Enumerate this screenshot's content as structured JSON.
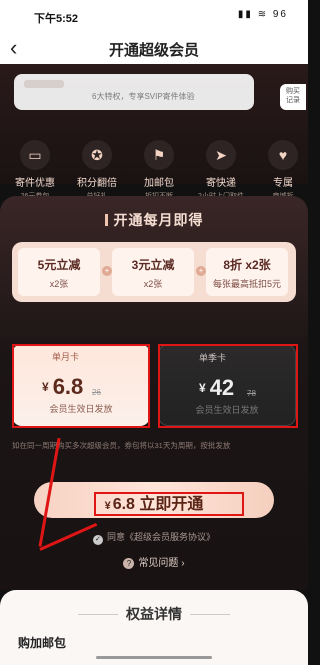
{
  "status_bar": {
    "time": "下午5:52",
    "icons": "▮▮ ≋ 96"
  },
  "nav": {
    "back": "‹",
    "title": "开通超级会员"
  },
  "member": {
    "subtitle": "6大特权，专享SVIP寄件体验",
    "buy_record": "购买\n记录"
  },
  "perks": [
    {
      "icon": "▭",
      "name": "寄件优惠",
      "desc": "26元券包"
    },
    {
      "icon": "✪",
      "name": "积分翻倍",
      "desc": "兑好礼"
    },
    {
      "icon": "⚑",
      "name": "加邮包",
      "desc": "折扣不断"
    },
    {
      "icon": "➤",
      "name": "寄快递",
      "desc": "2小时上门取件"
    },
    {
      "icon": "♥",
      "name": "专属",
      "desc": "商城折"
    }
  ],
  "panel": {
    "title": "开通每月即得"
  },
  "coupons": [
    {
      "title": "5元立减",
      "sub": "x2张"
    },
    {
      "title": "3元立减",
      "sub": "x2张"
    },
    {
      "title": "8折 x2张",
      "sub": "每张最高抵扣5元"
    }
  ],
  "cards": {
    "month": {
      "tag": "单月卡",
      "price": "6.8",
      "yen": "¥",
      "orig": "26",
      "desc": "会员生效日发放"
    },
    "season": {
      "tag": "单季卡",
      "price": "42",
      "yen": "¥",
      "orig": "78",
      "desc": "会员生效日发放"
    }
  },
  "notice": "如在同一周期购买多次超级会员，券包将以31天为周期，按批发放",
  "cta": {
    "yen": "¥",
    "text": "6.8 立即开通"
  },
  "agreement": {
    "check": "✓",
    "text": "同意《超级会员服务协议》"
  },
  "faq": {
    "icon": "?",
    "text": "常见问题 ›"
  },
  "details": {
    "title": "权益详情",
    "sub": "购加邮包"
  },
  "colors": {
    "accent": "#e01515",
    "cta": "#f6d2c3",
    "dark": "#181212"
  }
}
